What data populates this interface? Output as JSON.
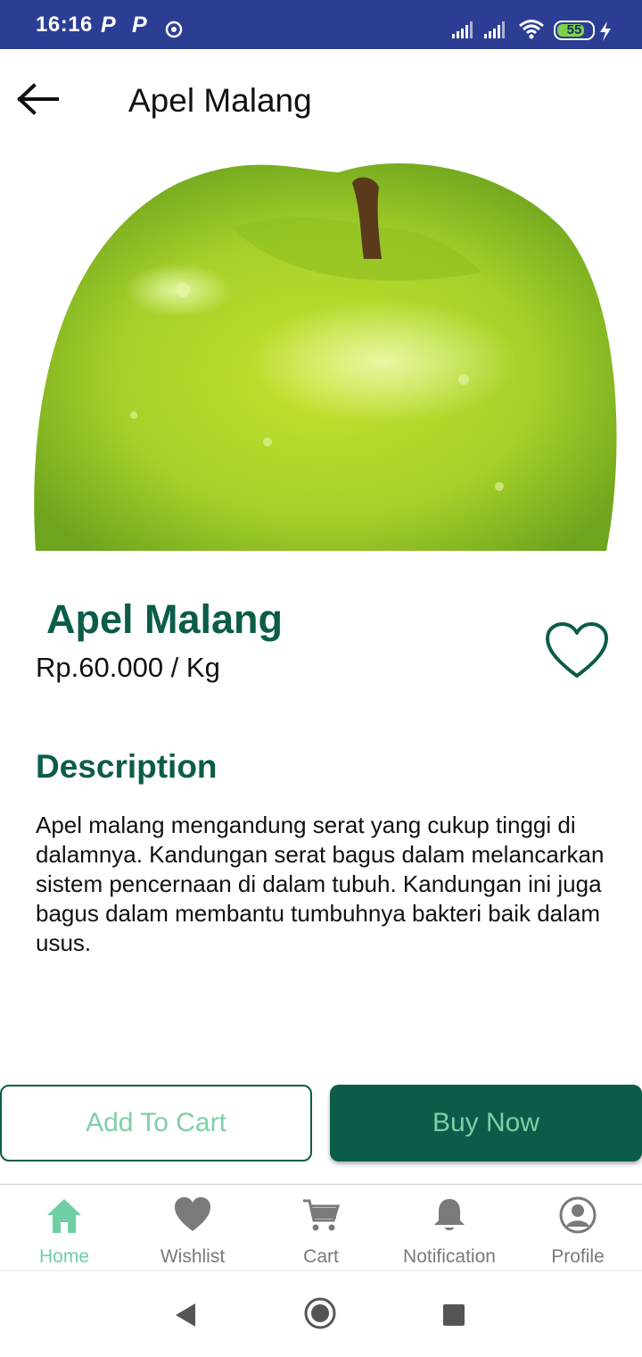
{
  "status_bar": {
    "time": "16:16",
    "notification_icons": [
      "P",
      "P"
    ],
    "battery_level": "55",
    "background_color": "#2c3e94",
    "icons": [
      "sync-icon",
      "signal-icon",
      "signal-icon",
      "wifi-icon",
      "battery-icon",
      "charging-icon"
    ]
  },
  "header": {
    "title": "Apel Malang",
    "back_icon": "arrow-left-icon"
  },
  "product": {
    "image": "green-apple-photo",
    "name": "Apel Malang",
    "price": "Rp.60.000 / Kg",
    "wishlist_icon": "heart-outline-icon"
  },
  "description": {
    "heading": "Description",
    "text": "Apel malang mengandung serat yang cukup tinggi di dalamnya. Kandungan serat bagus dalam melancarkan sistem pencernaan di dalam tubuh. Kandungan ini juga bagus dalam membantu tumbuhnya bakteri baik dalam usus."
  },
  "actions": {
    "add_to_cart": "Add To Cart",
    "buy_now": "Buy Now"
  },
  "bottom_nav": {
    "active": "Home",
    "items": [
      {
        "label": "Home",
        "icon": "home-icon"
      },
      {
        "label": "Wishlist",
        "icon": "heart-icon"
      },
      {
        "label": "Cart",
        "icon": "cart-icon"
      },
      {
        "label": "Notification",
        "icon": "bell-icon"
      },
      {
        "label": "Profile",
        "icon": "profile-icon"
      }
    ]
  },
  "colors": {
    "primary_dark_green": "#0b5c49",
    "accent_light_green": "#7fcfa6",
    "inactive_gray": "#7a7a7a",
    "status_bar_blue": "#2c3e94"
  }
}
